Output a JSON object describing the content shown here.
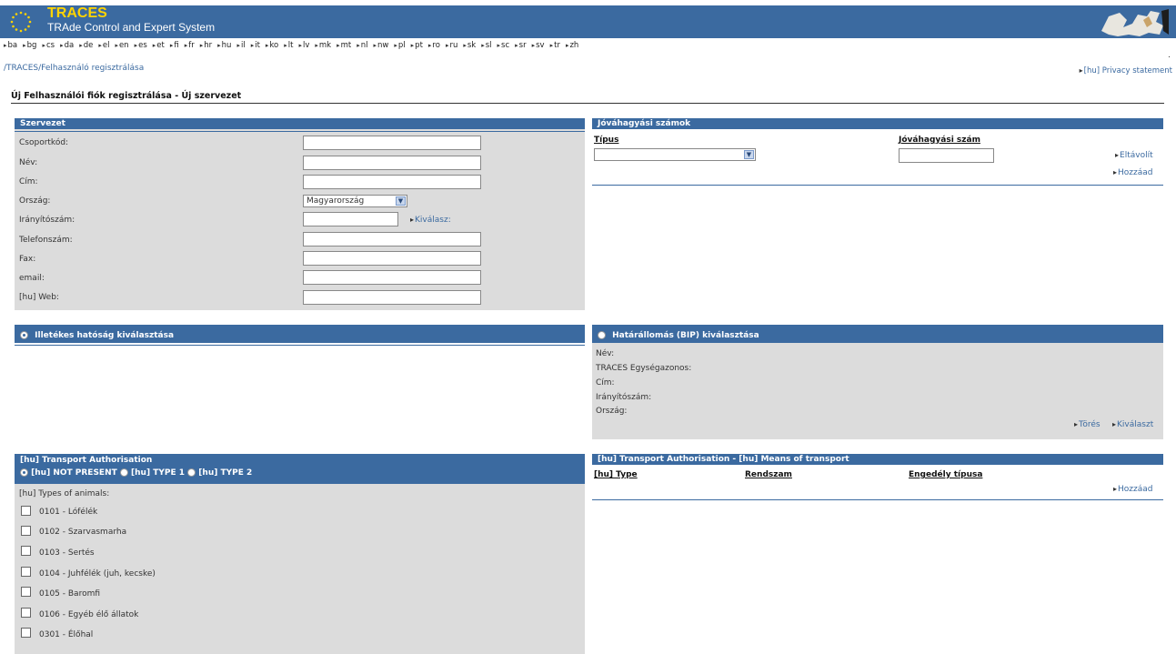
{
  "header": {
    "app_name": "TRACES",
    "app_subtitle": "TRAde Control and Expert System",
    "flag_icon": "eu-flag-icon",
    "map_icon": "europe-map-icon"
  },
  "languages": [
    "ba",
    "bg",
    "cs",
    "da",
    "de",
    "el",
    "en",
    "es",
    "et",
    "fi",
    "fr",
    "hr",
    "hu",
    "il",
    "it",
    "ko",
    "lt",
    "lv",
    "mk",
    "mt",
    "nl",
    "nw",
    "pl",
    "pt",
    "ro",
    "ru",
    "sk",
    "sl",
    "sc",
    "sr",
    "sv",
    "tr",
    "zh"
  ],
  "breadcrumb": "/TRACES/Felhasználó regisztrálása",
  "privacy_link": "[hu] Privacy statement",
  "page_title": "Új Felhasználói fiók regisztrálása - Új szervezet",
  "org": {
    "title": "Szervezet",
    "fields": {
      "group_code": {
        "label": "Csoportkód:",
        "value": ""
      },
      "name": {
        "label": "Név:",
        "value": ""
      },
      "address": {
        "label": "Cím:",
        "value": ""
      },
      "country": {
        "label": "Ország:",
        "value": "Magyarország"
      },
      "postcode": {
        "label": "Irányítószám:",
        "value": ""
      },
      "phone": {
        "label": "Telefonszám:",
        "value": ""
      },
      "fax": {
        "label": "Fax:",
        "value": ""
      },
      "email": {
        "label": "email:",
        "value": ""
      },
      "web": {
        "label": "[hu] Web:",
        "value": ""
      }
    },
    "select_link": "Kiválasz:"
  },
  "approval": {
    "title": "Jóváhagyási számok",
    "type_header": "Típus",
    "number_header": "Jóváhagyási szám",
    "type_value": "",
    "number_value": "",
    "remove_link": "Eltávolít",
    "add_link": "Hozzáad",
    "dot": "."
  },
  "authority": {
    "title": "Illetékes hatóság kiválasztása",
    "selected": true
  },
  "bip": {
    "title": "Határállomás (BIP) kiválasztása",
    "selected": false,
    "labels": [
      "Név:",
      "TRACES Egységazonos:",
      "Cím:",
      "Irányítószám:",
      "Ország:"
    ],
    "delete_link": "Törés",
    "select_link": "Kiválaszt"
  },
  "transport": {
    "title": "[hu] Transport Authorisation",
    "options": [
      "[hu] NOT PRESENT",
      "[hu] TYPE 1",
      "[hu] TYPE 2"
    ],
    "selected_index": 0,
    "animals_label": "[hu] Types of animals:",
    "animals": [
      "0101 - Lófélék",
      "0102 - Szarvasmarha",
      "0103 - Sertés",
      "0104 - Juhfélék (juh, kecske)",
      "0105 - Baromfi",
      "0106 - Egyéb élő állatok",
      "0301 - Élőhal"
    ]
  },
  "means": {
    "title": "[hu] Transport Authorisation - [hu] Means of transport",
    "col_type": "[hu] Type",
    "col_reg": "Rendszam",
    "col_license": "Engedély típusa",
    "add_link": "Hozzáad"
  }
}
